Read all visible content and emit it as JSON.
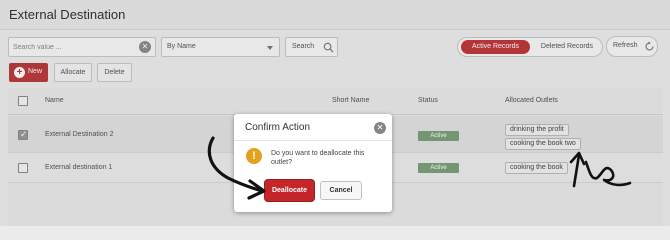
{
  "page": {
    "title": "External Destination"
  },
  "toolbar": {
    "search_placeholder": "Search value ...",
    "sort_select": "By Name",
    "search_button": "Search",
    "active_records": "Active Records",
    "deleted_records": "Deleted Records",
    "refresh": "Refresh",
    "new": "New",
    "allocate": "Allocate",
    "delete": "Delete"
  },
  "table": {
    "columns": [
      "Name",
      "Short Name",
      "Status",
      "Allocated Outlets"
    ],
    "rows": [
      {
        "name": "External Destination 2",
        "status": "Active",
        "outlets": [
          "drinking the profit",
          "cooking the book two"
        ],
        "checked": true
      },
      {
        "name": "External destination 1",
        "status": "Active",
        "outlets": [
          "cooking the book"
        ],
        "checked": false
      }
    ]
  },
  "dialog": {
    "title": "Confirm Action",
    "message": "Do you want to deallocate this outlet?",
    "confirm": "Deallocate",
    "cancel": "Cancel",
    "icon": "warning-icon"
  },
  "colors": {
    "accent": "#c0393b",
    "status_active": "#7ea07b",
    "warning": "#e2a21e"
  }
}
